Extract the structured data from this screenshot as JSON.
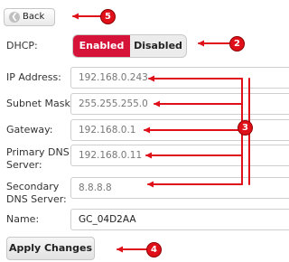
{
  "back_button": {
    "label": "Back",
    "icon": "chevron-left-icon"
  },
  "dhcp": {
    "label": "DHCP:",
    "enabled_label": "Enabled",
    "disabled_label": "Disabled",
    "selected": "Enabled"
  },
  "fields": {
    "ip_address": {
      "label": "IP Address:",
      "value": "192.168.0.243"
    },
    "subnet_mask": {
      "label": "Subnet Mask:",
      "value": "255.255.255.0"
    },
    "gateway": {
      "label": "Gateway:",
      "value": "192.168.0.1"
    },
    "primary_dns": {
      "label_line1": "Primary DNS",
      "label_line2": "Server:",
      "value": "192.168.0.11"
    },
    "secondary_dns": {
      "label_line1": "Secondary",
      "label_line2": "DNS Server:",
      "value": "8.8.8.8"
    },
    "name": {
      "label": "Name:",
      "value": "GC_04D2AA"
    }
  },
  "apply_button": {
    "label": "Apply Changes"
  },
  "callouts": [
    "5",
    "2",
    "3",
    "4"
  ],
  "colors": {
    "accent": "#d6143a",
    "callout": "#e0101a"
  }
}
